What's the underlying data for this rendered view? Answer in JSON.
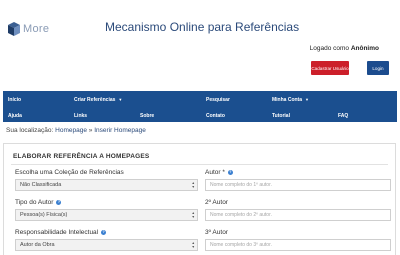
{
  "logo": {
    "text": "More",
    "icon": "cube-icon"
  },
  "header": {
    "title": "Mecanismo Online para Referências",
    "logged_prefix": "Logado como ",
    "logged_user": "Anônimo",
    "register_button": "Cadastrar Usuário",
    "login_button": "Login"
  },
  "nav": {
    "row1": [
      "Início",
      "Criar Referências",
      "Pesquisar",
      "Minha Conta"
    ],
    "row2": [
      "Ajuda",
      "Links",
      "Sobre",
      "Contato",
      "Tutorial",
      "FAQ"
    ]
  },
  "breadcrumb": {
    "prefix": "Sua localização: ",
    "item1": "Homepage",
    "separator": " » ",
    "item2": "Inserir Homepage"
  },
  "form": {
    "heading": "ELABORAR REFERÊNCIA A HOMEPAGES",
    "collection_label": "Escolha uma Coleção de Referências",
    "collection_value": "Não Classificada",
    "author_type_label": "Tipo do Autor",
    "author_type_value": "Pessoa(s) Física(s)",
    "responsibility_label": "Responsabilidade Intelectual",
    "responsibility_value": "Autor da Obra",
    "author1_label": "Autor *",
    "author1_placeholder": "Nome completo do 1º autor.",
    "author2_label": "2º Autor",
    "author2_placeholder": "Nome completo do 2º autor.",
    "author3_label": "3º Autor",
    "author3_placeholder": "Nome completo do 3º autor."
  },
  "colors": {
    "nav_bg": "#1b4f8f",
    "register_bg": "#cc1f2a",
    "login_bg": "#1c4c8e",
    "title": "#2b4a7a"
  }
}
